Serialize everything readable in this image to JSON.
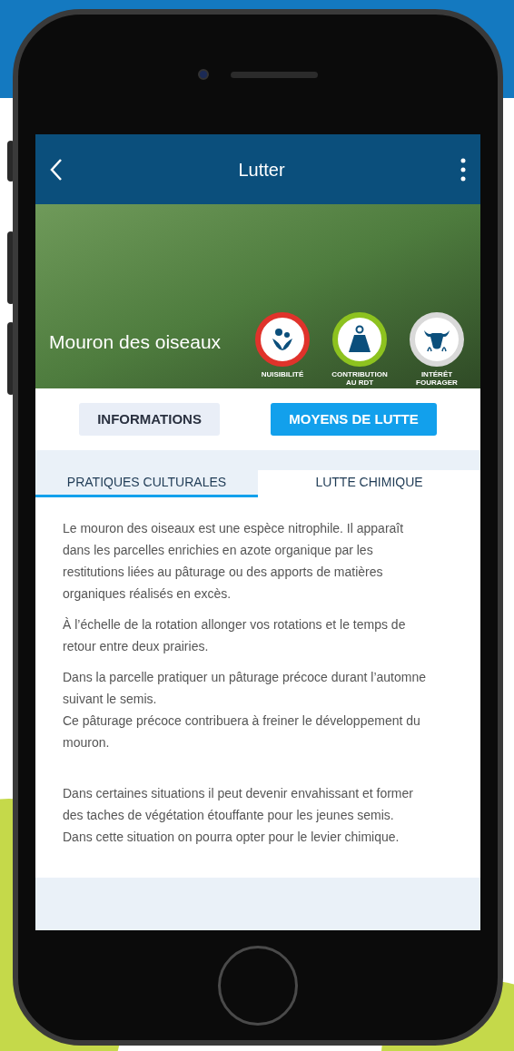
{
  "app_bar": {
    "title": "Lutter"
  },
  "hero": {
    "plant_name": "Mouron des oiseaux",
    "indicators": [
      {
        "kind": "plant",
        "label": "NUISIBILITÉ",
        "color": "#e0332b"
      },
      {
        "kind": "weight",
        "label": "CONTRIBUTION AU RDT",
        "color": "#8dc21f"
      },
      {
        "kind": "cow",
        "label": "INTÉRÊT FOURAGER",
        "color": "#d9d9d9"
      }
    ]
  },
  "main_tabs": [
    {
      "label": "INFORMATIONS",
      "selected": false
    },
    {
      "label": "MOYENS DE LUTTE",
      "selected": true
    }
  ],
  "sub_tabs": [
    {
      "label": "PRATIQUES CULTURALES",
      "selected": true
    },
    {
      "label": "LUTTE CHIMIQUE",
      "selected": false
    }
  ],
  "paragraphs": [
    [
      "Le mouron des oiseaux est une espèce nitrophile. Il apparaît dans les parcelles enrichies en azote organique par les restitutions liées au pâturage ou des apports de matières organiques réalisés en excès."
    ],
    [
      "À l’échelle de la rotation allonger vos rotations et le temps de retour entre deux prairies."
    ],
    [
      "Dans la parcelle pratiquer un pâturage précoce durant l’automne suivant le semis.",
      "Ce pâturage précoce contribuera à freiner le développement du mouron."
    ],
    [
      "Dans certaines situations il peut devenir envahissant et former des taches de végétation étouffante pour les jeunes semis.",
      "Dans cette situation on pourra opter pour le levier chimique."
    ]
  ]
}
